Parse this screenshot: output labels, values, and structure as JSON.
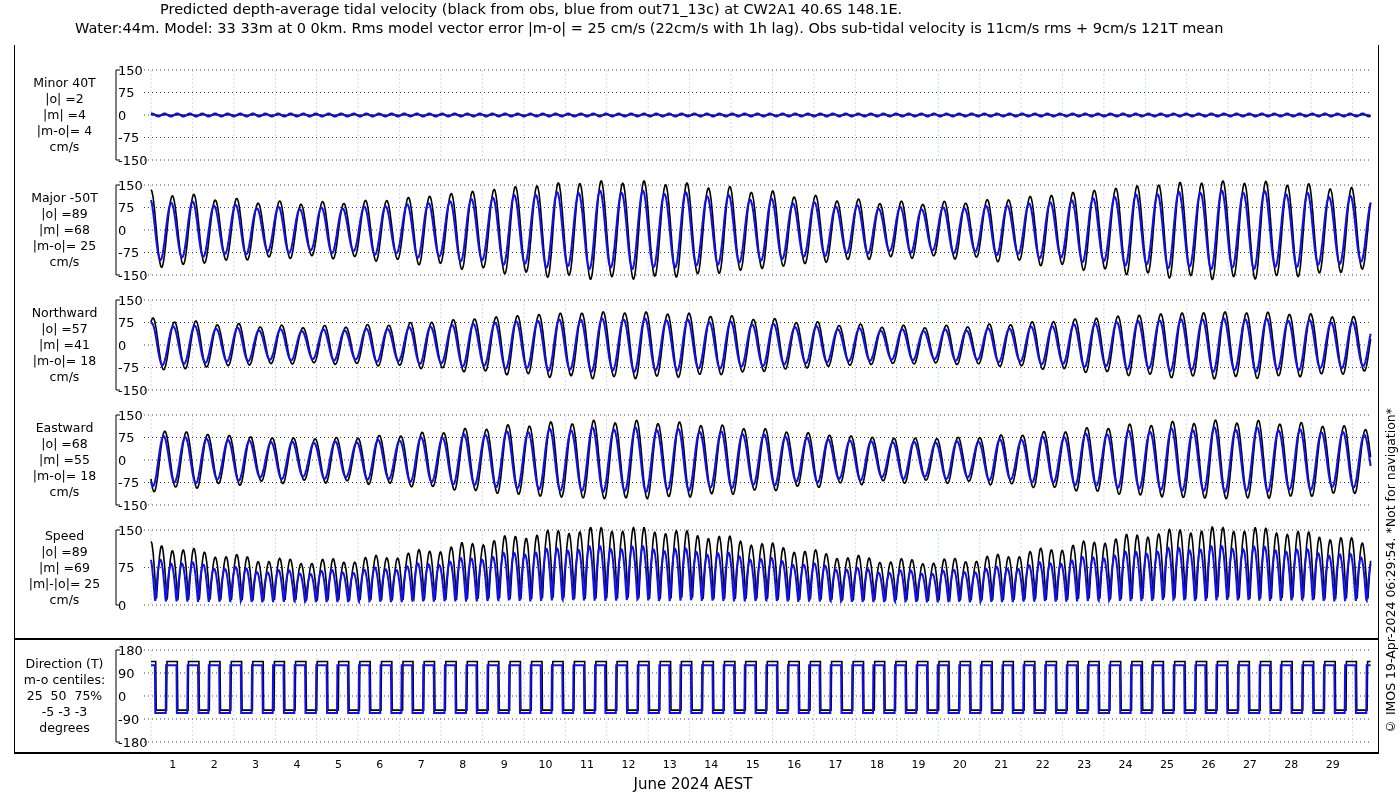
{
  "title_lines": [
    "Predicted depth-average tidal velocity (black from obs, blue from out71_13c) at CW2A1 40.6S 148.1E.",
    "Water:44m. Model: 33 33m at 0 0km. Rms model vector error |m-o| = 25 cm/s (22cm/s with 1h lag). Obs sub-tidal velocity is 11cm/s rms + 9cm/s 121T mean"
  ],
  "panels": [
    {
      "kind": "velocity",
      "label_lines": [
        "Minor 40T",
        "|o| =2",
        "|m| =4",
        "|m-o|= 4",
        "cm/s"
      ],
      "yticks": [
        "150",
        "75",
        "0",
        "-75",
        "-150"
      ]
    },
    {
      "kind": "velocity",
      "label_lines": [
        "Major -50T",
        "|o| =89",
        "|m| =68",
        "|m-o|= 25",
        "cm/s"
      ],
      "yticks": [
        "150",
        "75",
        "0",
        "-75",
        "-150"
      ]
    },
    {
      "kind": "velocity",
      "label_lines": [
        "Northward",
        "|o| =57",
        "|m| =41",
        "|m-o|= 18",
        "cm/s"
      ],
      "yticks": [
        "150",
        "75",
        "0",
        "-75",
        "-150"
      ]
    },
    {
      "kind": "velocity",
      "label_lines": [
        "Eastward",
        "|o| =68",
        "|m| =55",
        "|m-o|= 18",
        "cm/s"
      ],
      "yticks": [
        "150",
        "75",
        "0",
        "-75",
        "-150"
      ]
    },
    {
      "kind": "speed",
      "label_lines": [
        "Speed",
        "|o| =89",
        "|m| =69",
        "|m|-|o|= 25",
        "cm/s"
      ],
      "yticks": [
        "150",
        "75",
        "0"
      ]
    },
    {
      "kind": "direction",
      "label_lines": [
        "Direction (T)",
        "m-o centiles:",
        "25  50  75%",
        "-5 -3 -3",
        "degrees"
      ],
      "yticks": [
        "180",
        "90",
        "0",
        "-90",
        "-180"
      ]
    }
  ],
  "x_axis": {
    "ticks": [
      "1",
      "2",
      "3",
      "4",
      "5",
      "6",
      "7",
      "8",
      "9",
      "10",
      "11",
      "12",
      "13",
      "14",
      "15",
      "16",
      "17",
      "18",
      "19",
      "20",
      "21",
      "22",
      "23",
      "24",
      "25",
      "26",
      "27",
      "28",
      "29"
    ],
    "label": "June 2024 AEST"
  },
  "credit": "© IMOS 19-Apr-2024 06:29:54. *Not for navigation*"
}
